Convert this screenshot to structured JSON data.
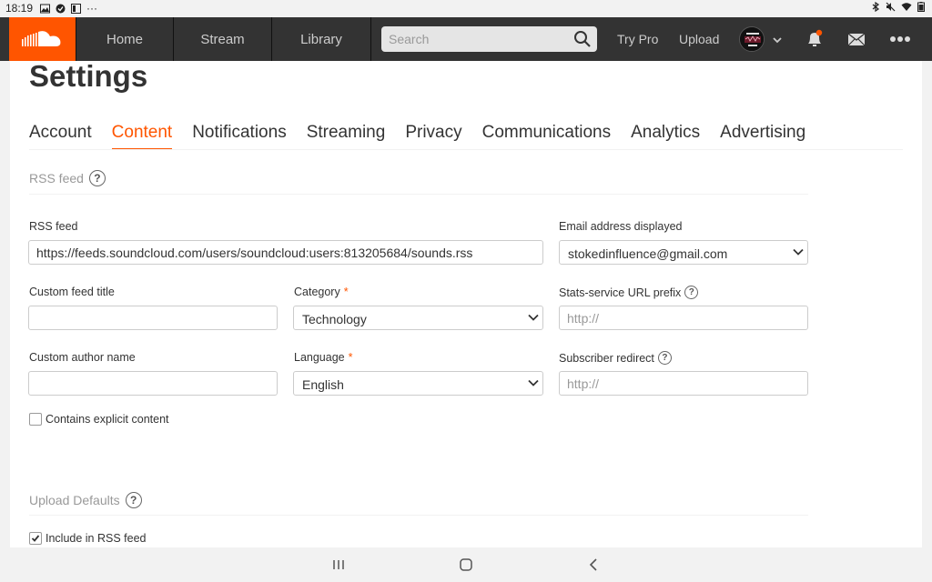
{
  "status_bar": {
    "time": "18:19",
    "more": "···"
  },
  "header": {
    "nav": {
      "home": "Home",
      "stream": "Stream",
      "library": "Library"
    },
    "search": {
      "placeholder": "Search"
    },
    "try_pro": "Try Pro",
    "upload": "Upload",
    "avatar_text": "STOKED ENCE",
    "icons": [
      "soundcloud-logo",
      "search-icon",
      "chevron-down-icon",
      "bell-icon",
      "mail-icon",
      "more-icon"
    ],
    "colors": {
      "header_bg": "#333333",
      "brand": "#ff5500",
      "notification_dot": "#ff5500"
    }
  },
  "page": {
    "title": "Settings",
    "tabs": [
      {
        "label": "Account",
        "active": false
      },
      {
        "label": "Content",
        "active": true
      },
      {
        "label": "Notifications",
        "active": false
      },
      {
        "label": "Streaming",
        "active": false
      },
      {
        "label": "Privacy",
        "active": false
      },
      {
        "label": "Communications",
        "active": false
      },
      {
        "label": "Analytics",
        "active": false
      },
      {
        "label": "Advertising",
        "active": false
      }
    ]
  },
  "rss": {
    "section_title": "RSS feed",
    "feed_label": "RSS feed",
    "feed_value": "https://feeds.soundcloud.com/users/soundcloud:users:813205684/sounds.rss",
    "email_label": "Email address displayed",
    "email_value": "stokedinfluence@gmail.com",
    "custom_title_label": "Custom feed title",
    "custom_title_value": "",
    "category_label": "Category",
    "category_value": "Technology",
    "stats_label": "Stats-service URL prefix",
    "stats_placeholder": "http://",
    "author_label": "Custom author name",
    "author_value": "",
    "language_label": "Language",
    "language_value": "English",
    "redirect_label": "Subscriber redirect",
    "redirect_placeholder": "http://",
    "explicit_label": "Contains explicit content",
    "explicit_checked": false,
    "required_mark": "*"
  },
  "upload_defaults": {
    "section_title": "Upload Defaults",
    "include_rss_label": "Include in RSS feed",
    "include_rss_checked": true
  },
  "help_glyph": "?"
}
